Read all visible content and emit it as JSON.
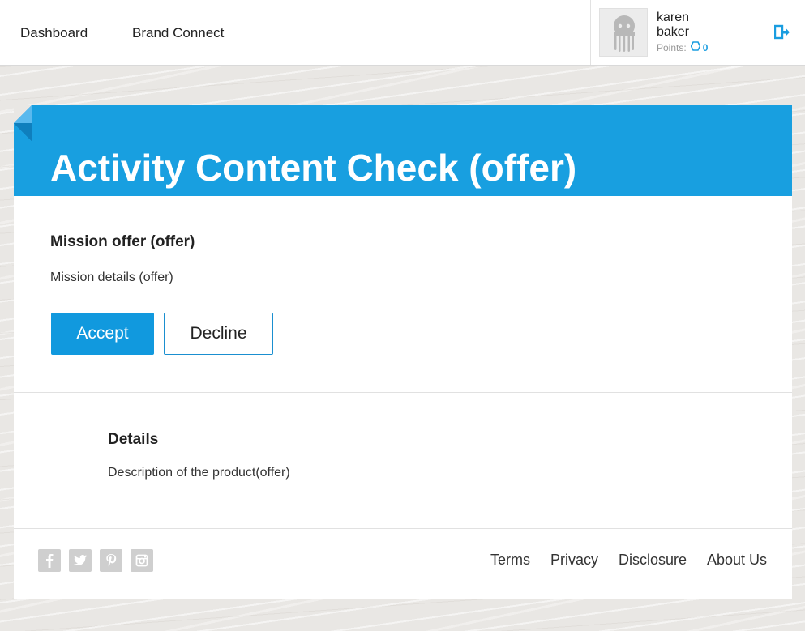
{
  "nav": {
    "items": [
      {
        "label": "Dashboard"
      },
      {
        "label": "Brand Connect"
      }
    ]
  },
  "user": {
    "first_name": "karen",
    "last_name": "baker",
    "points_label": "Points:",
    "points_value": "0",
    "avatar_icon": "octopus-avatar-icon",
    "logout_icon": "logout-icon"
  },
  "page": {
    "title": "Activity Content Check (offer)"
  },
  "mission": {
    "title": "Mission offer (offer)",
    "details": "Mission details (offer)",
    "accept_label": "Accept",
    "decline_label": "Decline"
  },
  "details": {
    "title": "Details",
    "description": "Description of the product(offer)"
  },
  "footer": {
    "social": [
      "facebook-icon",
      "twitter-icon",
      "pinterest-icon",
      "instagram-icon"
    ],
    "links": [
      {
        "label": "Terms"
      },
      {
        "label": "Privacy"
      },
      {
        "label": "Disclosure"
      },
      {
        "label": "About Us"
      }
    ]
  },
  "colors": {
    "accent": "#189fe0",
    "button": "#1199de",
    "background": "#e9e7e4"
  }
}
